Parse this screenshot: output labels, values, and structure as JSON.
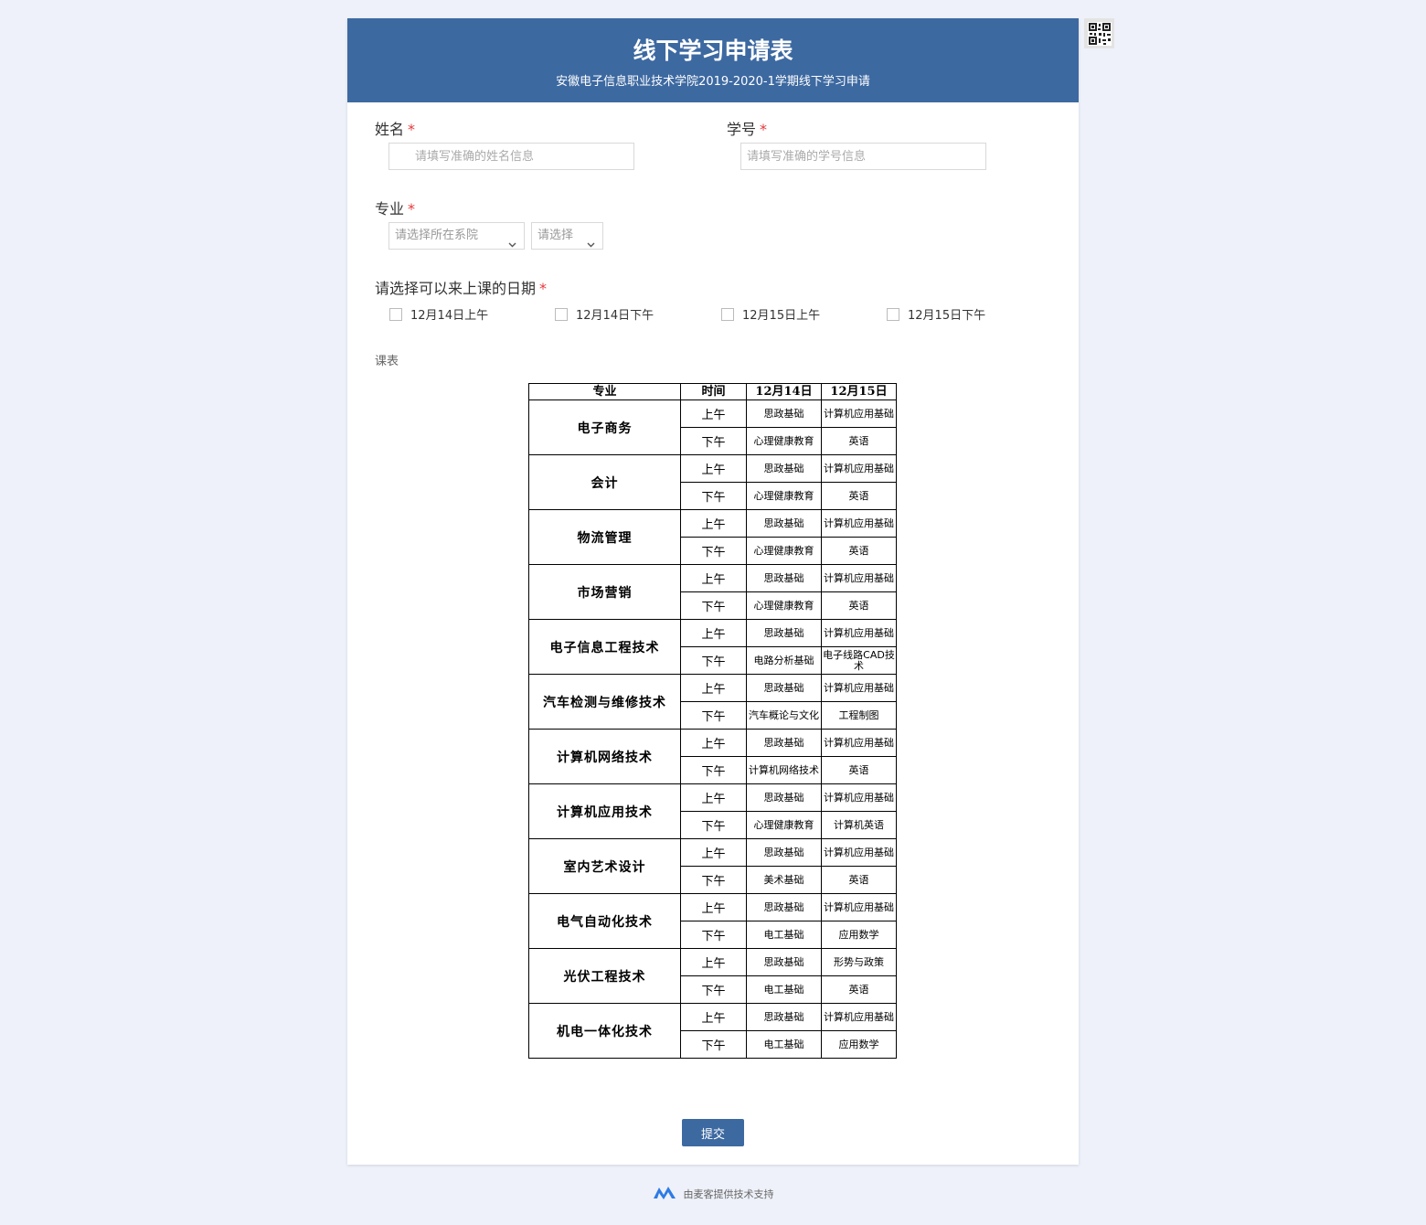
{
  "header": {
    "title": "线下学习申请表",
    "subtitle": "安徽电子信息职业技术学院2019-2020-1学期线下学习申请"
  },
  "fields": {
    "name": {
      "label": "姓名",
      "required_mark": "*",
      "placeholder": "请填写准确的姓名信息",
      "value": ""
    },
    "student_id": {
      "label": "学号",
      "required_mark": "*",
      "placeholder": "请填写准确的学号信息",
      "value": ""
    },
    "major": {
      "label": "专业",
      "required_mark": "*",
      "department_select": "请选择所在系院",
      "major_select": "请选择"
    },
    "dates": {
      "label": "请选择可以来上课的日期",
      "required_mark": "*",
      "options": [
        "12月14日上午",
        "12月14日下午",
        "12月15日上午",
        "12月15日下午"
      ]
    }
  },
  "schedule": {
    "label": "课表",
    "headers": [
      "专业",
      "时间",
      "12月14日",
      "12月15日"
    ],
    "time_am": "上午",
    "time_pm": "下午",
    "rows": [
      {
        "major": "电子商务",
        "am": [
          "思政基础",
          "计算机应用基础"
        ],
        "pm": [
          "心理健康教育",
          "英语"
        ]
      },
      {
        "major": "会计",
        "am": [
          "思政基础",
          "计算机应用基础"
        ],
        "pm": [
          "心理健康教育",
          "英语"
        ]
      },
      {
        "major": "物流管理",
        "am": [
          "思政基础",
          "计算机应用基础"
        ],
        "pm": [
          "心理健康教育",
          "英语"
        ]
      },
      {
        "major": "市场营销",
        "am": [
          "思政基础",
          "计算机应用基础"
        ],
        "pm": [
          "心理健康教育",
          "英语"
        ]
      },
      {
        "major": "电子信息工程技术",
        "am": [
          "思政基础",
          "计算机应用基础"
        ],
        "pm": [
          "电路分析基础",
          "电子线路CAD技术"
        ]
      },
      {
        "major": "汽车检测与维修技术",
        "am": [
          "思政基础",
          "计算机应用基础"
        ],
        "pm": [
          "汽车概论与文化",
          "工程制图"
        ]
      },
      {
        "major": "计算机网络技术",
        "am": [
          "思政基础",
          "计算机应用基础"
        ],
        "pm": [
          "计算机网络技术",
          "英语"
        ]
      },
      {
        "major": "计算机应用技术",
        "am": [
          "思政基础",
          "计算机应用基础"
        ],
        "pm": [
          "心理健康教育",
          "计算机英语"
        ]
      },
      {
        "major": "室内艺术设计",
        "am": [
          "思政基础",
          "计算机应用基础"
        ],
        "pm": [
          "美术基础",
          "英语"
        ]
      },
      {
        "major": "电气自动化技术",
        "am": [
          "思政基础",
          "计算机应用基础"
        ],
        "pm": [
          "电工基础",
          "应用数学"
        ]
      },
      {
        "major": "光伏工程技术",
        "am": [
          "思政基础",
          "形势与政策"
        ],
        "pm": [
          "电工基础",
          "英语"
        ]
      },
      {
        "major": "机电一体化技术",
        "am": [
          "思政基础",
          "计算机应用基础"
        ],
        "pm": [
          "电工基础",
          "应用数学"
        ]
      }
    ]
  },
  "submit_label": "提交",
  "footer_text": "由麦客提供技术支持",
  "colors": {
    "header": "#3d69a1",
    "page_bg": "#eef1f9",
    "required": "#e4393c",
    "logo": "#2d7be5"
  },
  "icons": {
    "qr": "qr-code-icon",
    "user": "user-icon",
    "chevron": "chevron-down-icon",
    "logo": "mikecrm-logo"
  }
}
